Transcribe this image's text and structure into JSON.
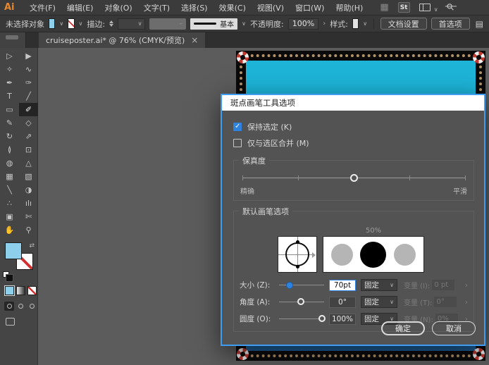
{
  "colors": {
    "accent_blue": "#3e9df0",
    "checkbox_blue": "#2e82e0",
    "poster_cyan": "#1db4d8",
    "poster_sea_blue": "#1e5f98",
    "rope_tan": "#b49366",
    "fill_swatch_blue": "#8ed0ec",
    "dialog_bg": "#535353"
  },
  "menubar": {
    "logo": "Ai",
    "items": [
      "文件(F)",
      "编辑(E)",
      "对象(O)",
      "文字(T)",
      "选择(S)",
      "效果(C)",
      "视图(V)",
      "窗口(W)",
      "帮助(H)"
    ],
    "stock_badge": "St"
  },
  "control_bar": {
    "status": "未选择对象",
    "stroke_label": "描边:",
    "brush_definition": "基本",
    "opacity_label": "不透明度:",
    "opacity_value": "100%",
    "style_label": "样式:",
    "doc_setup_button": "文档设置",
    "preferences_button": "首选项"
  },
  "document_tab": {
    "title": "cruiseposter.ai* @ 76% (CMYK/预览)",
    "close_label": "×"
  },
  "toolbar": {
    "tools": [
      {
        "name": "selection-tool",
        "glyph": "▷"
      },
      {
        "name": "direct-selection-tool",
        "glyph": "▶"
      },
      {
        "name": "magic-wand-tool",
        "glyph": "✧"
      },
      {
        "name": "lasso-tool",
        "glyph": "∿"
      },
      {
        "name": "pen-tool",
        "glyph": "✒"
      },
      {
        "name": "curvature-tool",
        "glyph": "✑"
      },
      {
        "name": "type-tool",
        "glyph": "T"
      },
      {
        "name": "line-segment-tool",
        "glyph": "╱"
      },
      {
        "name": "rectangle-tool",
        "glyph": "▭"
      },
      {
        "name": "blob-brush-tool",
        "glyph": "✐",
        "selected": true
      },
      {
        "name": "shaper-tool",
        "glyph": "✎"
      },
      {
        "name": "eraser-tool",
        "glyph": "◇"
      },
      {
        "name": "rotate-tool",
        "glyph": "↻"
      },
      {
        "name": "scale-tool",
        "glyph": "⇗"
      },
      {
        "name": "width-tool",
        "glyph": "≬"
      },
      {
        "name": "free-transform-tool",
        "glyph": "⊡"
      },
      {
        "name": "shape-builder-tool",
        "glyph": "◍"
      },
      {
        "name": "perspective-grid-tool",
        "glyph": "△"
      },
      {
        "name": "mesh-tool",
        "glyph": "▦"
      },
      {
        "name": "gradient-tool",
        "glyph": "▧"
      },
      {
        "name": "eyedropper-tool",
        "glyph": "╲"
      },
      {
        "name": "blend-tool",
        "glyph": "◑"
      },
      {
        "name": "symbol-sprayer-tool",
        "glyph": "∴"
      },
      {
        "name": "column-graph-tool",
        "glyph": "ılı"
      },
      {
        "name": "artboard-tool",
        "glyph": "▣"
      },
      {
        "name": "slice-tool",
        "glyph": "✄"
      },
      {
        "name": "hand-tool",
        "glyph": "✋"
      },
      {
        "name": "zoom-tool",
        "glyph": "⚲"
      }
    ]
  },
  "dialog": {
    "title": "斑点画笔工具选项",
    "keep_selected_label": "保持选定 (K)",
    "keep_selected_checked": true,
    "merge_only_label": "仅与选区合并 (M)",
    "merge_only_checked": false,
    "fidelity": {
      "label": "保真度",
      "min_label": "精确",
      "max_label": "平滑",
      "value_pct": 50
    },
    "defaults": {
      "label": "默认画笔选项",
      "preview_value": "50%"
    },
    "params": [
      {
        "label": "大小 (Z):",
        "value": "70pt",
        "mode": "固定",
        "variation_label": "变量 (I):",
        "variation_value": "0 pt",
        "slider_pct": 24,
        "handle": "filled"
      },
      {
        "label": "角度 (A):",
        "value": "0°",
        "mode": "固定",
        "variation_label": "变量 (T):",
        "variation_value": "0°",
        "slider_pct": 48,
        "handle": "hollow"
      },
      {
        "label": "圆度 (O):",
        "value": "100%",
        "mode": "固定",
        "variation_label": "变量 (N):",
        "variation_value": "0%",
        "slider_pct": 96,
        "handle": "hollow"
      }
    ],
    "ok_button": "确定",
    "cancel_button": "取消"
  }
}
